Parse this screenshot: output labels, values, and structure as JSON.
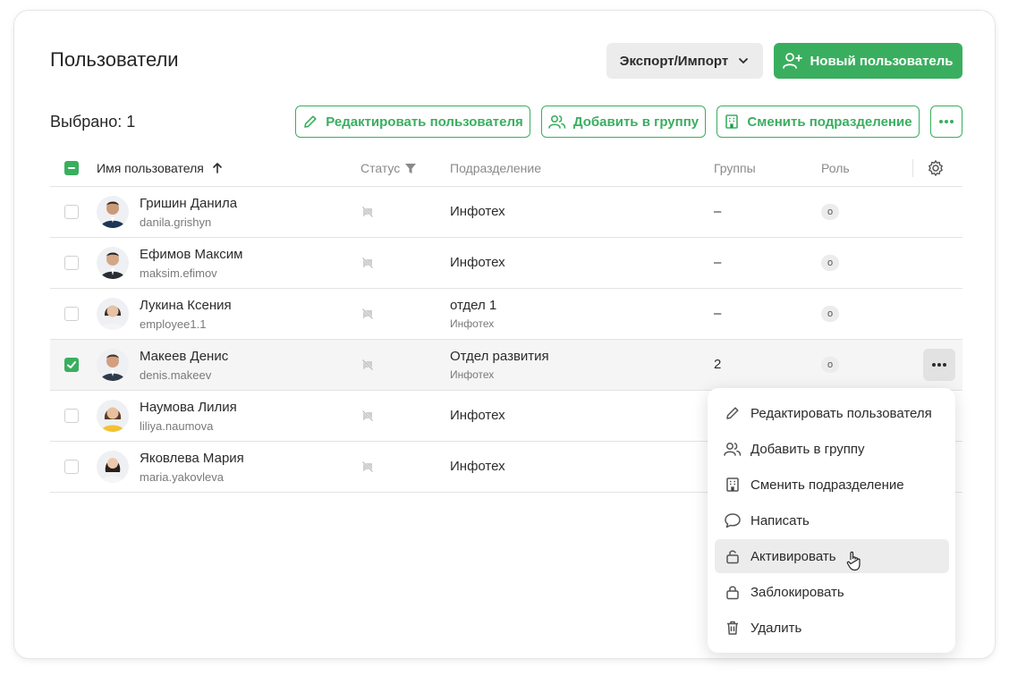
{
  "page": {
    "title": "Пользователи"
  },
  "toolbar": {
    "export_label": "Экспорт/Импорт",
    "new_user_label": "Новый пользователь",
    "selected_label": "Выбрано: 1",
    "edit_user_label": "Редактировать пользователя",
    "add_group_label": "Добавить в группу",
    "change_dept_label": "Сменить подразделение"
  },
  "table": {
    "columns": {
      "name": "Имя пользователя",
      "status": "Статус",
      "department": "Подразделение",
      "groups": "Группы",
      "role": "Роль"
    },
    "rows": [
      {
        "name": "Гришин Данила",
        "login": "danila.grishyn",
        "department": "Инфотех",
        "sub_department": "",
        "groups": "–",
        "role": "o",
        "selected": false
      },
      {
        "name": "Ефимов Максим",
        "login": "maksim.efimov",
        "department": "Инфотех",
        "sub_department": "",
        "groups": "–",
        "role": "o",
        "selected": false
      },
      {
        "name": "Лукина Ксения",
        "login": "employee1.1",
        "department": "отдел 1",
        "sub_department": "Инфотех",
        "groups": "–",
        "role": "o",
        "selected": false
      },
      {
        "name": "Макеев Денис",
        "login": "denis.makeev",
        "department": "Отдел развития",
        "sub_department": "Инфотех",
        "groups": "2",
        "role": "o",
        "selected": true
      },
      {
        "name": "Наумова Лилия",
        "login": "liliya.naumova",
        "department": "Инфотех",
        "sub_department": "",
        "groups": "",
        "role": "",
        "selected": false
      },
      {
        "name": "Яковлева Мария",
        "login": "maria.yakovleva",
        "department": "Инфотех",
        "sub_department": "",
        "groups": "",
        "role": "",
        "selected": false
      }
    ]
  },
  "context_menu": {
    "items": [
      {
        "label": "Редактировать пользователя",
        "icon": "pencil-icon"
      },
      {
        "label": "Добавить в группу",
        "icon": "users-icon"
      },
      {
        "label": "Сменить подразделение",
        "icon": "building-icon"
      },
      {
        "label": "Написать",
        "icon": "chat-icon"
      },
      {
        "label": "Активировать",
        "icon": "lock-open-icon",
        "hovered": true
      },
      {
        "label": "Заблокировать",
        "icon": "lock-icon"
      },
      {
        "label": "Удалить",
        "icon": "trash-icon"
      }
    ]
  },
  "colors": {
    "accent": "#3aae5f",
    "row_selected": "#f5f5f5",
    "hover": "#ececec"
  }
}
